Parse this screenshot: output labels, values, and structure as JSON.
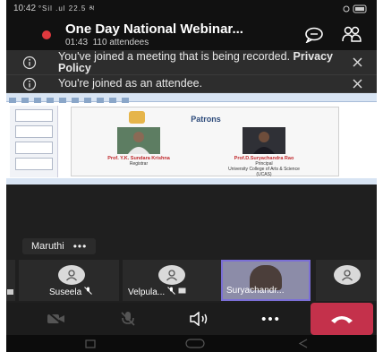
{
  "status_bar": {
    "time": "10:42",
    "signal": "°Sil .ul 22.5 མ"
  },
  "meeting": {
    "title": "One Day National Webinar...",
    "elapsed": "01:43",
    "attendees": "110 attendees"
  },
  "banners": {
    "recording_text": "You've joined a meeting that is being recorded.",
    "privacy_link": "Privacy Policy",
    "attendee_text": "You're joined as an attendee."
  },
  "shared_slide": {
    "title": "Patrons",
    "patron1_name": "Prof. Y.K. Sundara Krishna",
    "patron1_role": "Registrar",
    "patron2_name": "Prof.D.Suryachandra Rao",
    "patron2_role": "Principal",
    "patron2_org": "University College of Arts & Science (UCAS)"
  },
  "active_speaker": {
    "name": "Maruthi",
    "more": "•••"
  },
  "participants": [
    {
      "name": "Suseela"
    },
    {
      "name": "Velpula..."
    },
    {
      "name": "Suryachandr..."
    }
  ],
  "controls": {
    "more": "•••"
  },
  "colors": {
    "record": "#e0393e",
    "hangup": "#c4314b",
    "video_border": "#7b6fd6"
  }
}
